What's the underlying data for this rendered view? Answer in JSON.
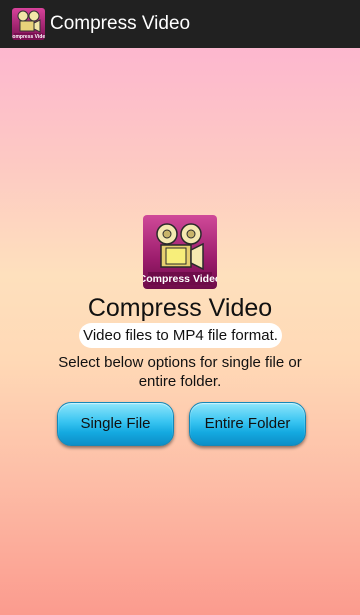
{
  "action_bar": {
    "title": "Compress Video",
    "icon": "compress-video-app-icon"
  },
  "main": {
    "logo": "compress-video-logo",
    "logo_caption": "Compress Video",
    "title": "Compress Video",
    "subtitle": "Video files to MP4 file format.",
    "description": "Select below options for single file or entire folder."
  },
  "buttons": {
    "single_file": "Single File",
    "entire_folder": "Entire Folder"
  },
  "colors": {
    "action_bar": "#212121",
    "button_accent": "#14a9e0",
    "logo_purple": "#8e1a64"
  }
}
